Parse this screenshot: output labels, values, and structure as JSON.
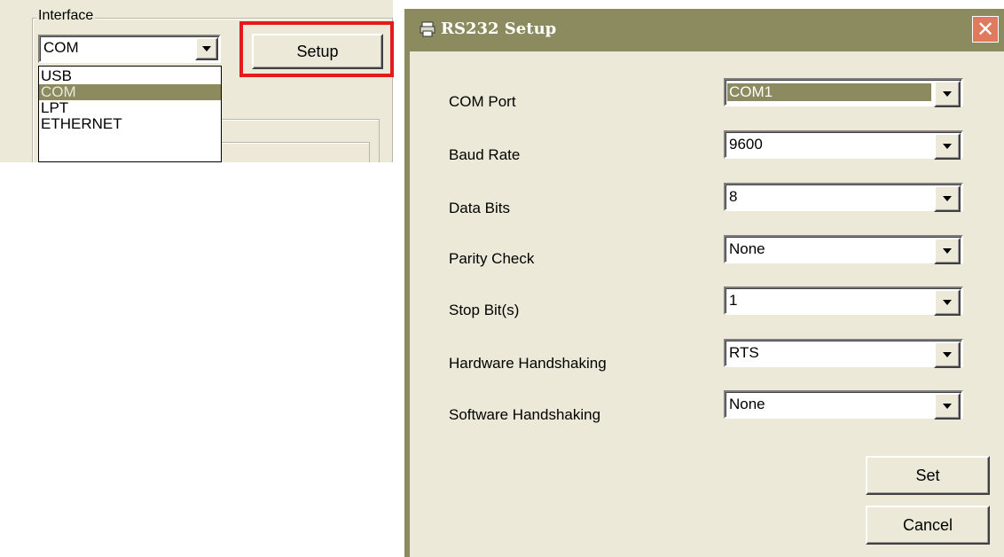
{
  "interface_panel": {
    "group_label": "Interface",
    "combo_value": "COM",
    "setup_button": "Setup",
    "options": [
      "USB",
      "COM",
      "LPT",
      "ETHERNET"
    ],
    "selected_option": "COM"
  },
  "dialog": {
    "title": "RS232 Setup",
    "close_symbol": "✕",
    "fields": [
      {
        "label": "COM Port",
        "value": "COM1"
      },
      {
        "label": "Baud Rate",
        "value": "9600"
      },
      {
        "label": "Data Bits",
        "value": "8"
      },
      {
        "label": "Parity Check",
        "value": "None"
      },
      {
        "label": "Stop Bit(s)",
        "value": "1"
      },
      {
        "label": "Hardware Handshaking",
        "value": "RTS"
      },
      {
        "label": "Software Handshaking",
        "value": "None"
      }
    ],
    "set_button": "Set",
    "cancel_button": "Cancel"
  },
  "colors": {
    "highlight": "#e41a1c",
    "titlebar": "#8b8b5f",
    "selection": "#8b8b5f"
  },
  "icons": {
    "title_icon": "printer-icon",
    "close_icon": "close-icon",
    "dropdown_arrow": "chevron-down-icon"
  }
}
